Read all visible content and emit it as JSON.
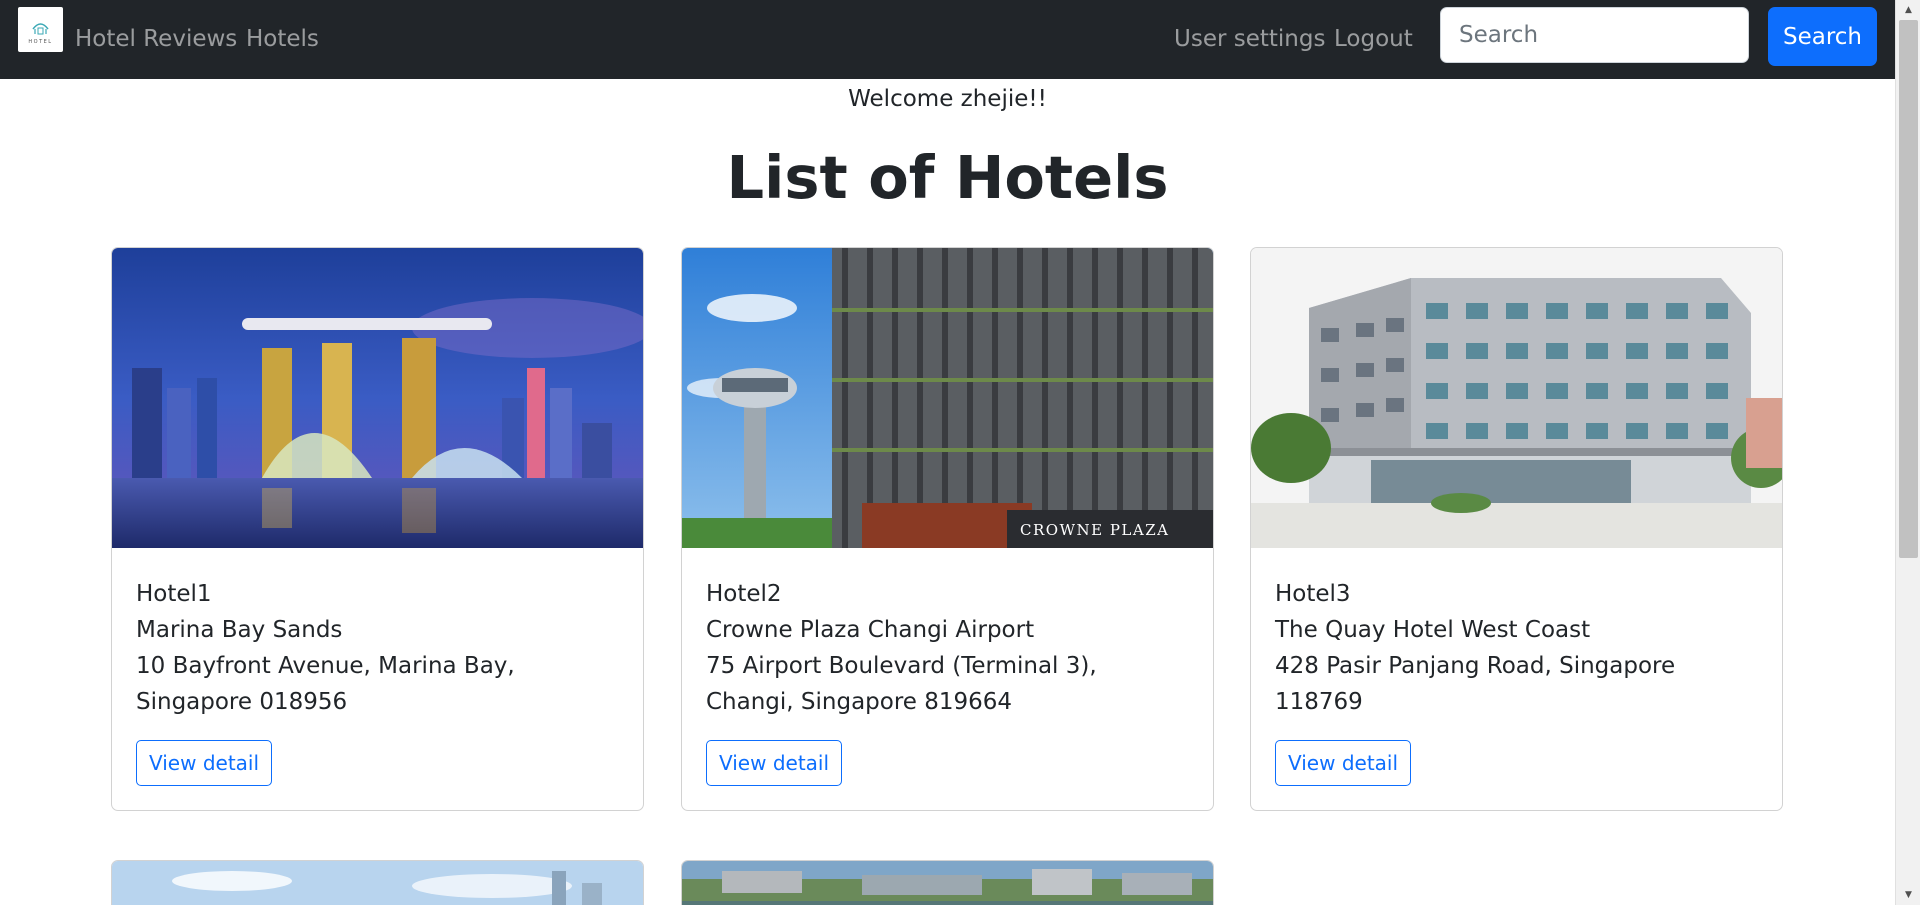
{
  "navbar": {
    "logo_icon": "hotel-logo-icon",
    "brand": "Hotel Reviews",
    "hotels_link": "Hotels",
    "user_settings": "User settings",
    "logout": "Logout",
    "search_placeholder": "Search",
    "search_value": "",
    "search_button": "Search",
    "colors": {
      "background": "#212529",
      "search_button": "#0d6efd"
    }
  },
  "main": {
    "welcome": "Welcome zhejie!!",
    "title": "List of Hotels"
  },
  "hotels": [
    {
      "id_label": "Hotel1",
      "name": "Marina Bay Sands",
      "address": "10 Bayfront Avenue, Marina Bay, Singapore 018956",
      "button": "View detail",
      "image": "marina-bay-sands-night-skyline"
    },
    {
      "id_label": "Hotel2",
      "name": "Crowne Plaza Changi Airport",
      "address": "75 Airport Boulevard (Terminal 3), Changi, Singapore 819664",
      "button": "View detail",
      "image": "crowne-plaza-changi-airport-facade",
      "image_sign": "CROWNE PLAZA"
    },
    {
      "id_label": "Hotel3",
      "name": "The Quay Hotel West Coast",
      "address": "428 Pasir Panjang Road, Singapore 118769",
      "button": "View detail",
      "image": "quay-hotel-building-facade"
    }
  ],
  "partial_cards": [
    {
      "image": "city-skyline-partial"
    },
    {
      "image": "aerial-city-partial"
    }
  ]
}
